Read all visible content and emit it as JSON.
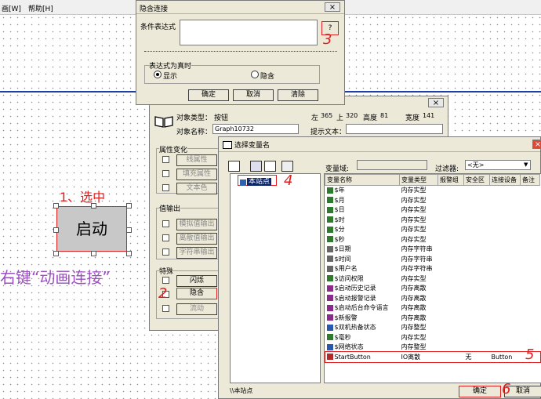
{
  "menubar": {
    "item_window": "画[W]",
    "item_help": "帮助[H]"
  },
  "link_dialog": {
    "title": "隐含连接",
    "condition_label": "条件表达式",
    "help_button": "?",
    "when_true_group": "表达式为真时",
    "option_show": "显示",
    "option_hide": "隐含",
    "ok": "确定",
    "cancel": "取消",
    "clear": "清除"
  },
  "props_dialog": {
    "object_type_label": "对象类型：",
    "object_type_value": "按钮",
    "left_label": "左",
    "left_value": "365",
    "top_label": "上",
    "top_value": "320",
    "height_label": "高度",
    "height_value": "81",
    "width_label": "宽度",
    "width_value": "141",
    "object_name_label": "对象名称：",
    "object_name_value": "Graph10732",
    "tooltip_label": "提示文本：",
    "attr_group": "属性变化",
    "line_attr": "线属性",
    "fill_attr": "填充属性",
    "text_color": "文本色",
    "value_out_group": "值输出",
    "analog_out": "模拟值输出",
    "discrete_out": "离散值输出",
    "string_out": "字符串输出",
    "special_group": "特殊",
    "flash": "闪烁",
    "hide": "隐含",
    "flow": "流动"
  },
  "var_dialog": {
    "title": "选择变量名",
    "var_domain_label": "变量域:",
    "filter_label": "过滤器:",
    "filter_value": "<无>",
    "tree_node": "本站点",
    "status_path": "\\\\本站点",
    "columns": [
      "变量名称",
      "变量类型",
      "报警组",
      "安全区",
      "连接设备",
      "备注"
    ],
    "rows": [
      {
        "name": "$年",
        "type": "内存实型",
        "alarm": "",
        "safe": "",
        "device": "",
        "note": "",
        "icon": "grid"
      },
      {
        "name": "$月",
        "type": "内存实型",
        "alarm": "",
        "safe": "",
        "device": "",
        "note": "",
        "icon": "grid"
      },
      {
        "name": "$日",
        "type": "内存实型",
        "alarm": "",
        "safe": "",
        "device": "",
        "note": "",
        "icon": "grid"
      },
      {
        "name": "$时",
        "type": "内存实型",
        "alarm": "",
        "safe": "",
        "device": "",
        "note": "",
        "icon": "grid"
      },
      {
        "name": "$分",
        "type": "内存实型",
        "alarm": "",
        "safe": "",
        "device": "",
        "note": "",
        "icon": "grid"
      },
      {
        "name": "$秒",
        "type": "内存实型",
        "alarm": "",
        "safe": "",
        "device": "",
        "note": "",
        "icon": "grid"
      },
      {
        "name": "$日期",
        "type": "内存字符串",
        "alarm": "",
        "safe": "",
        "device": "",
        "note": "",
        "icon": "str"
      },
      {
        "name": "$时间",
        "type": "内存字符串",
        "alarm": "",
        "safe": "",
        "device": "",
        "note": "",
        "icon": "str"
      },
      {
        "name": "$用户名",
        "type": "内存字符串",
        "alarm": "",
        "safe": "",
        "device": "",
        "note": "",
        "icon": "str"
      },
      {
        "name": "$访问权限",
        "type": "内存实型",
        "alarm": "",
        "safe": "",
        "device": "",
        "note": "",
        "icon": "grid"
      },
      {
        "name": "$启动历史记录",
        "type": "内存离散",
        "alarm": "",
        "safe": "",
        "device": "",
        "note": "",
        "icon": "disc"
      },
      {
        "name": "$启动报警记录",
        "type": "内存离散",
        "alarm": "",
        "safe": "",
        "device": "",
        "note": "",
        "icon": "disc"
      },
      {
        "name": "$启动后台命令语言",
        "type": "内存离散",
        "alarm": "",
        "safe": "",
        "device": "",
        "note": "",
        "icon": "disc"
      },
      {
        "name": "$新报警",
        "type": "内存离散",
        "alarm": "",
        "safe": "",
        "device": "",
        "note": "",
        "icon": "disc"
      },
      {
        "name": "$双机热备状态",
        "type": "内存整型",
        "alarm": "",
        "safe": "",
        "device": "",
        "note": "",
        "icon": "int"
      },
      {
        "name": "$毫秒",
        "type": "内存实型",
        "alarm": "",
        "safe": "",
        "device": "",
        "note": "",
        "icon": "grid"
      },
      {
        "name": "$网络状态",
        "type": "内存整型",
        "alarm": "",
        "safe": "",
        "device": "",
        "note": "",
        "icon": "int"
      },
      {
        "name": "StartButton",
        "type": "IO离散",
        "alarm": "",
        "safe": "无",
        "device": "Button",
        "note": "",
        "icon": "io"
      }
    ],
    "ok": "确定",
    "cancel": "取消"
  },
  "canvas": {
    "button_label": "启动"
  },
  "annotations": {
    "select_note": "1、选中",
    "right_click_note": "右键“动画连接”",
    "n2": "2",
    "n3": "3",
    "n4": "4",
    "n5": "5",
    "n6": "6"
  },
  "colors": {
    "annotation_red": "#e02020",
    "annotation_purple": "#9b4fc0",
    "highlight_blue": "#0a246a"
  }
}
